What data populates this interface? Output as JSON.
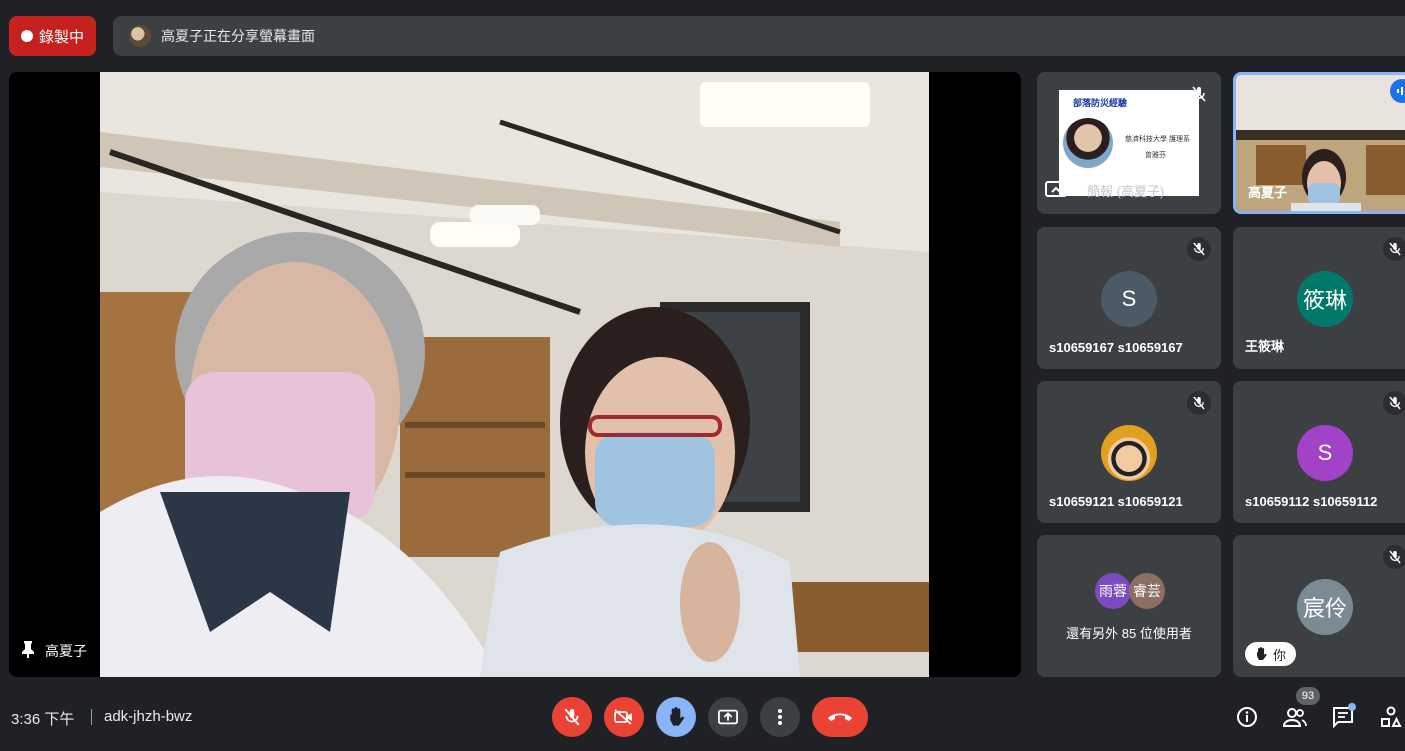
{
  "recording": {
    "label": "錄製中"
  },
  "banner": {
    "text": "高夏子正在分享螢幕畫面"
  },
  "main": {
    "presenter_name": "高夏子"
  },
  "tiles": {
    "presentation": {
      "name": "簡報 (高夏子)",
      "slide_title": "部落防災經驗",
      "slide_school": "慈濟科技大學 護理系",
      "slide_author": "曾雅芬"
    },
    "speaker": {
      "name": "高夏子"
    },
    "t1": {
      "initial": "S",
      "name": "s10659167 s10659167",
      "color": "#4a5a66"
    },
    "t2": {
      "initial": "筱琳",
      "name": "王筱琳",
      "color": "#00796b"
    },
    "t3": {
      "name": "s10659121 s10659121"
    },
    "t4": {
      "initial": "S",
      "name": "s10659112 s10659112",
      "color": "#a142c7"
    },
    "others": {
      "a1": "雨蓉",
      "a2": "睿芸",
      "label": "還有另外 85 位使用者"
    },
    "self": {
      "initial": "宸伶",
      "badge": "你",
      "color": "#7a8b94"
    }
  },
  "bottom": {
    "time": "3:36 下午",
    "meeting_code": "adk-jhzh-bwz",
    "participants_count": "93"
  },
  "colors": {
    "red": "#ea4335",
    "blue": "#8ab4f8",
    "dark": "#3c4043"
  }
}
